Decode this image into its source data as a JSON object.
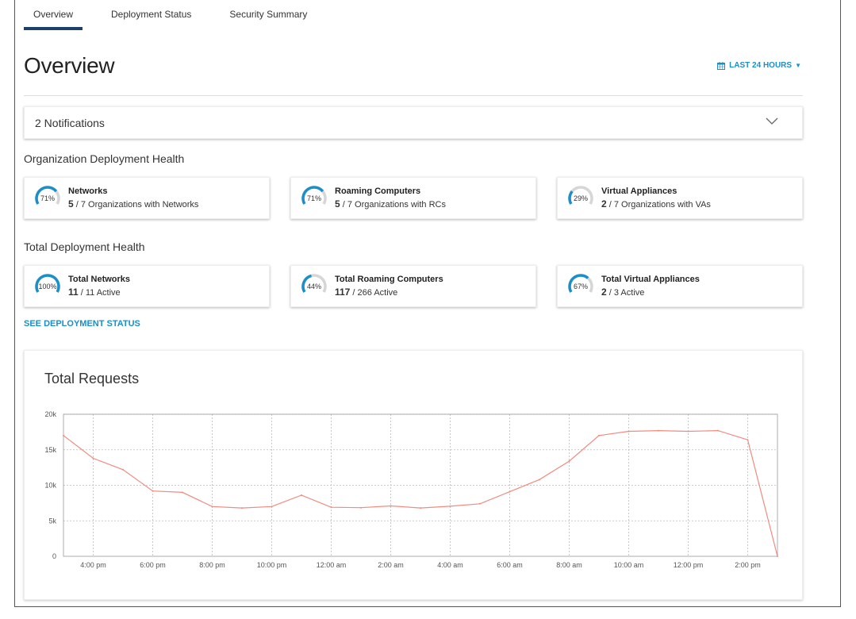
{
  "tabs": [
    {
      "label": "Overview",
      "active": true
    },
    {
      "label": "Deployment Status",
      "active": false
    },
    {
      "label": "Security Summary",
      "active": false
    }
  ],
  "page": {
    "title": "Overview",
    "timeframe": "LAST 24 HOURS",
    "timeframe_icon": "calendar-icon"
  },
  "notifications": {
    "label": "2 Notifications"
  },
  "org_health": {
    "title": "Organization Deployment Health",
    "cards": [
      {
        "pct": "71%",
        "value": 0.71,
        "title": "Networks",
        "count": "5",
        "rest": " / 7 Organizations with Networks"
      },
      {
        "pct": "71%",
        "value": 0.71,
        "title": "Roaming Computers",
        "count": "5",
        "rest": " / 7 Organizations with RCs"
      },
      {
        "pct": "29%",
        "value": 0.29,
        "title": "Virtual Appliances",
        "count": "2",
        "rest": " / 7 Organizations with VAs"
      }
    ]
  },
  "total_health": {
    "title": "Total Deployment Health",
    "cards": [
      {
        "pct": "100%",
        "value": 1.0,
        "title": "Total Networks",
        "count": "11",
        "rest": " / 11 Active"
      },
      {
        "pct": "44%",
        "value": 0.44,
        "title": "Total Roaming Computers",
        "count": "117",
        "rest": " / 266 Active"
      },
      {
        "pct": "67%",
        "value": 0.67,
        "title": "Total Virtual Appliances",
        "count": "2",
        "rest": " / 3 Active"
      }
    ]
  },
  "see_deployment_link": "SEE DEPLOYMENT STATUS",
  "colors": {
    "accent": "#1a8fc9",
    "tab_indicator": "#1d3f6e",
    "series": "#f08b80"
  },
  "chart_data": {
    "type": "line",
    "title": "Total Requests",
    "xlabel": "",
    "ylabel": "",
    "ylim": [
      0,
      20000
    ],
    "y_ticks": [
      "0",
      "5k",
      "10k",
      "15k",
      "20k"
    ],
    "x_tick_labels": [
      "4:00 pm",
      "6:00 pm",
      "8:00 pm",
      "10:00 pm",
      "12:00 am",
      "2:00 am",
      "4:00 am",
      "6:00 am",
      "8:00 am",
      "10:00 am",
      "12:00 pm",
      "2:00 pm"
    ],
    "grid": true,
    "series": [
      {
        "name": "",
        "x": [
          "3:00 pm",
          "4:00 pm",
          "5:00 pm",
          "6:00 pm",
          "7:00 pm",
          "8:00 pm",
          "9:00 pm",
          "10:00 pm",
          "11:00 pm",
          "12:00 am",
          "1:00 am",
          "2:00 am",
          "3:00 am",
          "4:00 am",
          "5:00 am",
          "6:00 am",
          "7:00 am",
          "8:00 am",
          "9:00 am",
          "10:00 am",
          "11:00 am",
          "12:00 pm",
          "1:00 pm",
          "2:00 pm",
          "3:00 pm"
        ],
        "values": [
          17000,
          13800,
          12200,
          9200,
          9000,
          7000,
          6800,
          7000,
          8600,
          6900,
          6850,
          7100,
          6800,
          7050,
          7400,
          9100,
          10800,
          13400,
          17000,
          17600,
          17700,
          17600,
          17700,
          16400,
          0
        ]
      }
    ]
  }
}
